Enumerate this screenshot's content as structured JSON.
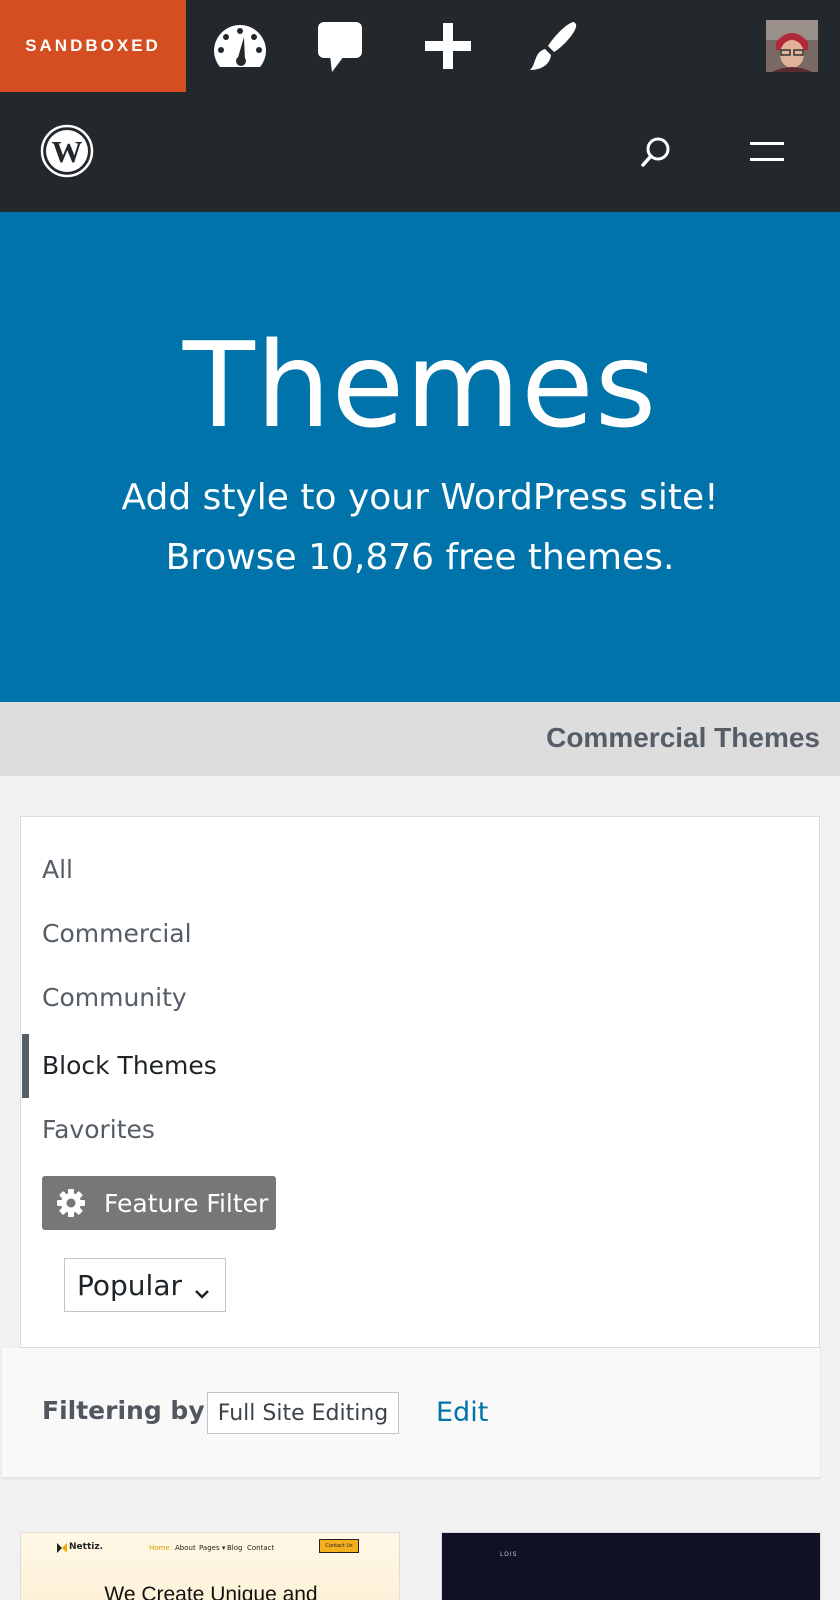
{
  "adminbar": {
    "site_label": "SANDBOXED",
    "icons": [
      "dashboard-icon",
      "comment-icon",
      "plus-icon",
      "brush-icon"
    ]
  },
  "colors": {
    "admin_bg": "#23282d",
    "sandbox_accent": "#d54e21",
    "hero_blue": "#0073aa",
    "link_blue": "#0073aa",
    "active_bar": "#555d66",
    "feature_btn": "#777777"
  },
  "hero": {
    "title": "Themes",
    "line1": "Add style to your WordPress site!",
    "line2": "Browse 10,876 free themes."
  },
  "commercial_link": "Commercial Themes",
  "filters": {
    "items": [
      {
        "label": "All"
      },
      {
        "label": "Commercial"
      },
      {
        "label": "Community"
      },
      {
        "label": "Block Themes"
      },
      {
        "label": "Favorites"
      }
    ],
    "active": "Block Themes",
    "feature_filter_label": "Feature Filter",
    "sort_selected": "Popular"
  },
  "filtering_by": {
    "label": "Filtering by:",
    "tag": "Full Site Editing",
    "edit_label": "Edit"
  },
  "cards": [
    {
      "brand": "Nettiz.",
      "nav": [
        "Home",
        "About",
        "Pages ▾",
        "Blog",
        "Contact"
      ],
      "cta": "Contact Us",
      "headline": "We Create Unique and"
    },
    {
      "brand": "LOIS"
    }
  ]
}
